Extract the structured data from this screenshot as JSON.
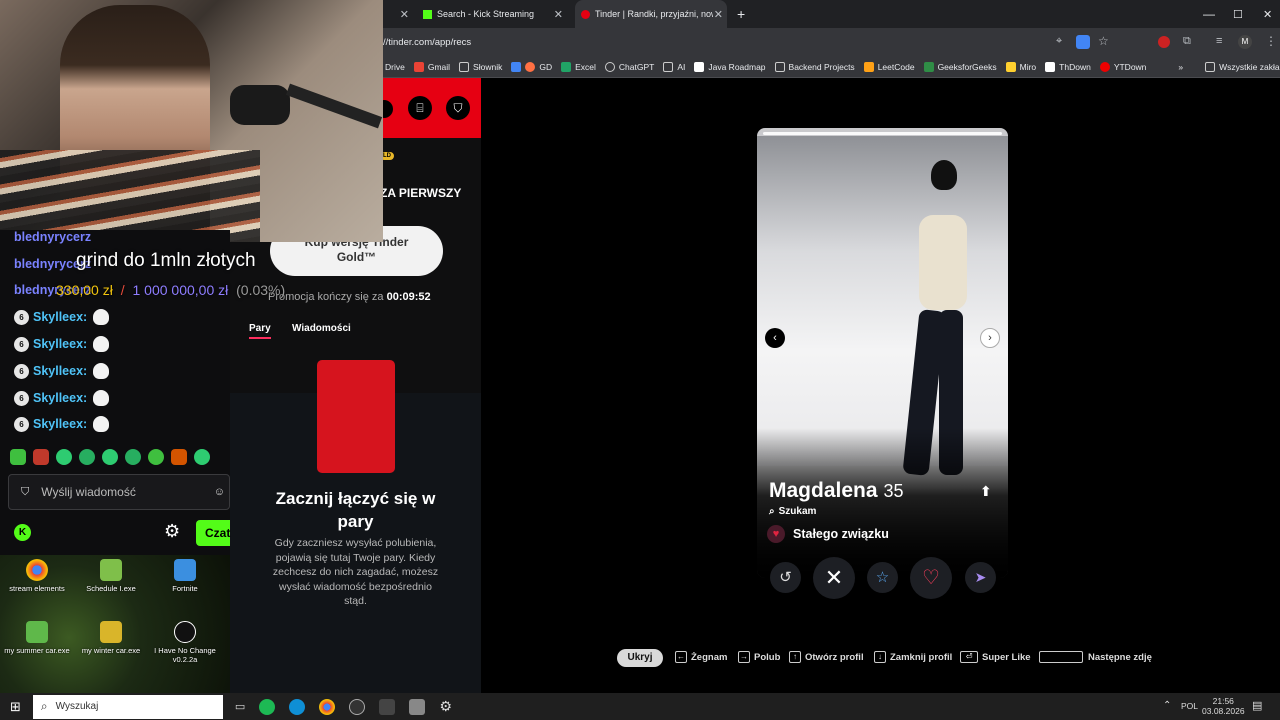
{
  "browser": {
    "tabs": [
      {
        "label": "Search - Kick Streaming"
      },
      {
        "label": "Tinder | Randki, przyjaźni, nowe"
      }
    ],
    "url": "//tinder.com/app/recs",
    "bookmarks": [
      "Drive",
      "Gmail",
      "Słownik",
      "GD",
      "Excel",
      "ChatGPT",
      "AI",
      "Java Roadmap",
      "Backend Projects",
      "LeetCode",
      "GeeksforGeeks",
      "Miro",
      "ThDown",
      "YTDown"
    ],
    "all_bookmarks": "Wszystkie zakładki",
    "profile_initial": "M"
  },
  "stream": {
    "overlay_text": "grind do 1mln złotych",
    "goal_current": "330,00 zł",
    "goal_sep": "/",
    "goal_target": "1 000 000,00 zł",
    "goal_pct": "(0.03%)",
    "chat": [
      {
        "user": "blednyrycerz",
        "msg": ""
      },
      {
        "user": "blednyrycerz",
        "msg": ""
      },
      {
        "user": "blednyrycerz",
        "msg": ""
      },
      {
        "user": "Skylleex:",
        "badge": "6"
      },
      {
        "user": "Skylleex:",
        "badge": "6"
      },
      {
        "user": "Skylleex:",
        "badge": "6"
      },
      {
        "user": "Skylleex:",
        "badge": "6"
      },
      {
        "user": "Skylleex:",
        "badge": "6"
      }
    ],
    "chat_placeholder": "Wyślij wiadomość",
    "chat_button": "Czat"
  },
  "desktop_icons": [
    {
      "label": "stream elements"
    },
    {
      "label": "Schedule I.exe"
    },
    {
      "label": "Fortnite"
    },
    {
      "label": "my summer car.exe"
    },
    {
      "label": "my winter car.exe"
    },
    {
      "label": "I Have No Change v0.2.2a"
    }
  ],
  "tinder_left": {
    "gold_badge": "LD",
    "promo_title": "ZA PIERWSZY",
    "gold_button": "Kup wersję Tinder Gold™",
    "promo_ends": "Promocja kończy się za",
    "promo_timer": "00:09:52",
    "tabs": [
      "Pary",
      "Wiadomości"
    ],
    "empty_title": "Zacznij łączyć się w pary",
    "empty_body": "Gdy zaczniesz wysyłać polubienia, pojawią się tutaj Twoje pary. Kiedy zechcesz do nich zagadać, możesz wysłać wiadomość bezpośrednio stąd."
  },
  "profile": {
    "name": "Magdalena",
    "age": "35",
    "seeking_label": "Szukam",
    "seeking_value": "Stałego związku"
  },
  "shortcuts": {
    "hide": "Ukryj",
    "nope": "Żegnam",
    "like": "Polub",
    "open": "Otwórz profil",
    "close": "Zamknij profil",
    "super": "Super Like",
    "next": "Następne zdję"
  },
  "taskbar": {
    "search": "Wyszukaj",
    "lang": "POL",
    "time": "21:56",
    "date": "03.08.2026"
  },
  "colors": {
    "tinder_red": "#e60012",
    "kick_green": "#53fc18",
    "chat_user": "#7a82ff",
    "skylleex": "#4fc3f7"
  }
}
